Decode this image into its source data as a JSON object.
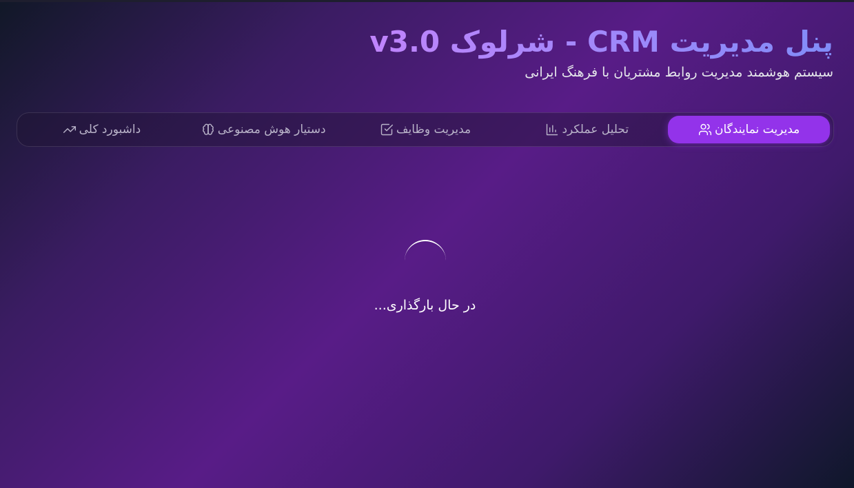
{
  "app": {
    "title": "پنل مدیریت CRM - شرلوک v3.0",
    "subtitle": "سیستم هوشمند مدیریت روابط مشتریان با فرهنگ ایرانی"
  },
  "tabs": [
    {
      "label": "داشبورد کلی",
      "icon": "trending-up-icon",
      "active": false
    },
    {
      "label": "دستیار هوش مصنوعی",
      "icon": "brain-icon",
      "active": false
    },
    {
      "label": "مدیریت وظایف",
      "icon": "check-square-icon",
      "active": false
    },
    {
      "label": "تحلیل عملکرد",
      "icon": "bar-chart-icon",
      "active": false
    },
    {
      "label": "مدیریت نمایندگان",
      "icon": "users-icon",
      "active": true
    }
  ],
  "loading": {
    "text": "در حال بارگذاری..."
  },
  "colors": {
    "accent": "#9333ea",
    "title_from": "#c084fc",
    "title_to": "#818cf8"
  }
}
